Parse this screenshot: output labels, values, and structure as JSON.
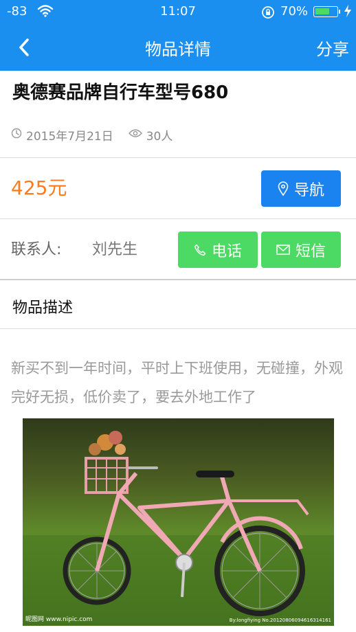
{
  "status_bar": {
    "signal": "-83",
    "time": "11:07",
    "battery_percent": "70%",
    "battery_level": 0.7
  },
  "navbar": {
    "title": "物品详情",
    "share_label": "分享"
  },
  "item": {
    "title": "奥德赛品牌自行车型号680",
    "date": "2015年7月21日",
    "views": "30人",
    "price": "425元"
  },
  "actions": {
    "navigate_label": "导航",
    "call_label": "电话",
    "sms_label": "短信"
  },
  "contact": {
    "label": "联系人:",
    "name": "刘先生"
  },
  "description": {
    "section_title": "物品描述",
    "text": "新买不到一年时间，平时上下班使用，无碰撞，外观完好无损，低价卖了，要去外地工作了"
  },
  "photo": {
    "watermark_left": "昵图网 www.nipic.com",
    "watermark_right": "By:longfiying No.20120806094616314161"
  },
  "colors": {
    "header_blue": "#1a8ff0",
    "price_orange": "#ff7a1a",
    "nav_button_blue": "#1a83f0",
    "action_green": "#4cd964"
  },
  "icons": {
    "back": "chevron-left-icon",
    "clock": "clock-icon",
    "eye": "eye-icon",
    "location": "location-pin-icon",
    "phone": "phone-icon",
    "mail": "mail-icon"
  }
}
